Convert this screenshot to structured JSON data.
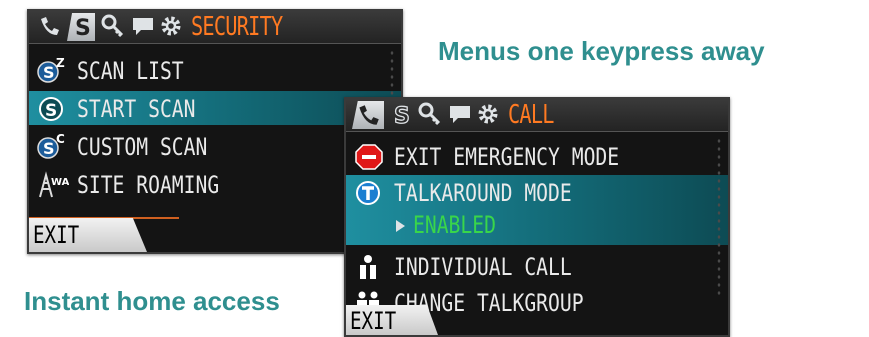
{
  "captions": {
    "menus": "Menus one keypress away",
    "home": "Instant home access"
  },
  "colors": {
    "accent_orange": "#ff7a22",
    "selection_teal": "#1f8fa0",
    "enabled_green": "#39d64a",
    "caption_teal": "#2f8f8f"
  },
  "security_screen": {
    "title": "SECURITY",
    "tabs": [
      "phone-icon",
      "scan-icon",
      "key-icon",
      "message-icon",
      "gear-icon"
    ],
    "active_tab": "scan-icon",
    "items": [
      {
        "label": "SCAN LIST",
        "icon": "scan-list-icon",
        "selected": false
      },
      {
        "label": "START SCAN",
        "icon": "start-scan-icon",
        "selected": true
      },
      {
        "label": "CUSTOM SCAN",
        "icon": "custom-scan-icon",
        "selected": false
      },
      {
        "label": "SITE ROAMING",
        "icon": "site-roaming-icon",
        "selected": false
      }
    ],
    "softkey": "EXIT"
  },
  "call_screen": {
    "title": "CALL",
    "tabs": [
      "phone-icon",
      "scan-icon",
      "key-icon",
      "message-icon",
      "gear-icon"
    ],
    "active_tab": "phone-icon",
    "items": [
      {
        "label": "EXIT EMERGENCY MODE",
        "icon": "emergency-stop-icon",
        "selected": false
      },
      {
        "label": "TALKAROUND MODE",
        "icon": "talkaround-icon",
        "selected": true,
        "sub_value": "ENABLED"
      },
      {
        "label": "INDIVIDUAL CALL",
        "icon": "person-icon",
        "selected": false
      },
      {
        "label": "CHANGE TALKGROUP",
        "icon": "talkgroup-icon",
        "selected": false
      }
    ],
    "softkey": "EXIT"
  }
}
